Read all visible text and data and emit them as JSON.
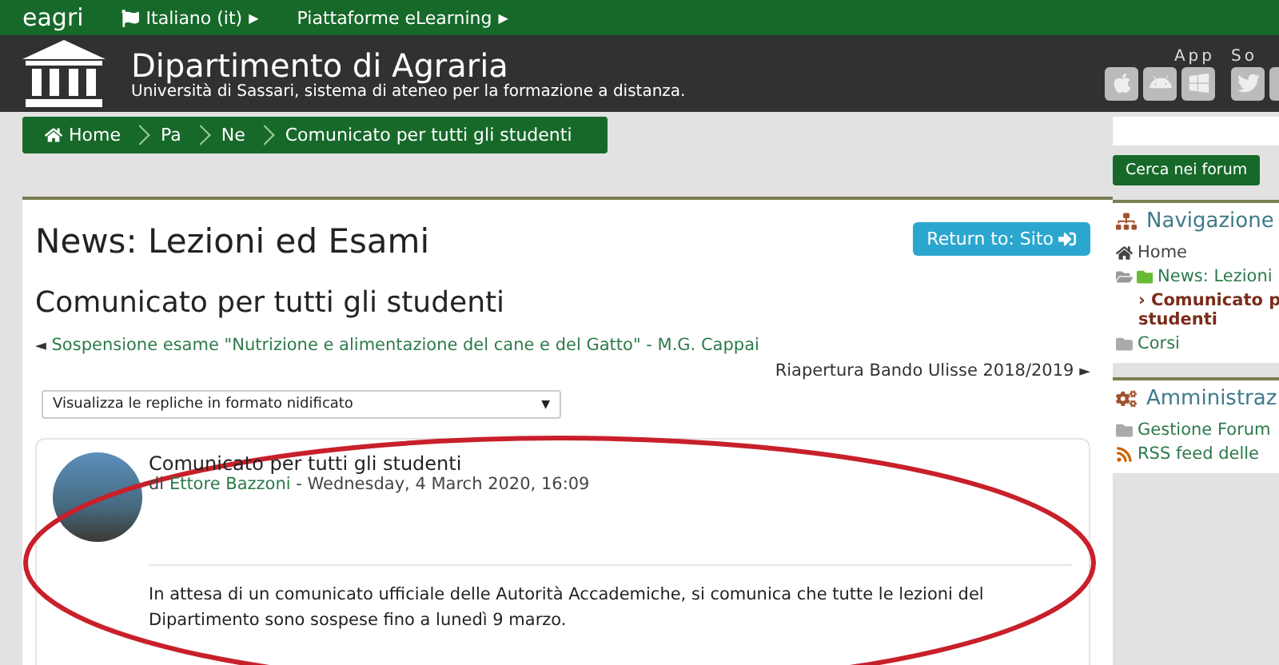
{
  "topbar": {
    "brand": "eagri",
    "language": "Italiano (it)",
    "language_arrow": "▶",
    "platforms": "Piattaforme eLearning",
    "platforms_arrow": "▶"
  },
  "header": {
    "title": "Dipartimento di Agraria",
    "subtitle": "Università di Sassari, sistema di ateneo per la formazione a distanza.",
    "app_label": "App",
    "social_label": "So"
  },
  "breadcrumb": [
    {
      "label": "Home",
      "kind": "home"
    },
    {
      "label": "Pa",
      "kind": "link"
    },
    {
      "label": "Ne",
      "kind": "link"
    },
    {
      "label": "Comunicato per tutti gli studenti",
      "kind": "link"
    }
  ],
  "main": {
    "heading": "News: Lezioni ed Esami",
    "return_button": "Return to: Sito",
    "discussion_title": "Comunicato per tutti gli studenti",
    "prev": {
      "arrow": "◄",
      "label": "Sospensione esame \"Nutrizione e alimentazione del cane e del Gatto\" - M.G. Cappai"
    },
    "next": {
      "arrow": "►",
      "label": "Riapertura Bando Ulisse 2018/2019"
    },
    "display_select": {
      "value": "Visualizza le repliche in formato nidificato",
      "caret": "▼"
    },
    "post": {
      "subject": "Comunicato per tutti gli studenti",
      "by": "di",
      "author": "Ettore Bazzoni",
      "date": " - Wednesday, 4 March 2020, 16:09",
      "body": "In attesa di un comunicato ufficiale delle Autorità Accademiche, si comunica che tutte le lezioni del Dipartimento sono sospese fino a lunedì 9 marzo."
    }
  },
  "sidebar": {
    "search_button": "Cerca nei forum",
    "blocks": [
      {
        "title": "Navigazione",
        "kind": "navigation",
        "items": [
          {
            "label": "Home",
            "kind": "home"
          },
          {
            "label": "News: Lezioni",
            "kind": "forum"
          },
          {
            "label": "Comunicato p studenti",
            "kind": "current",
            "marker": "›"
          },
          {
            "label": "Corsi",
            "kind": "folder"
          }
        ]
      },
      {
        "title": "Amministraz",
        "kind": "admin",
        "items": [
          {
            "label": "Gestione Forum",
            "kind": "folder"
          },
          {
            "label": "RSS feed delle",
            "kind": "rss"
          }
        ]
      }
    ]
  }
}
